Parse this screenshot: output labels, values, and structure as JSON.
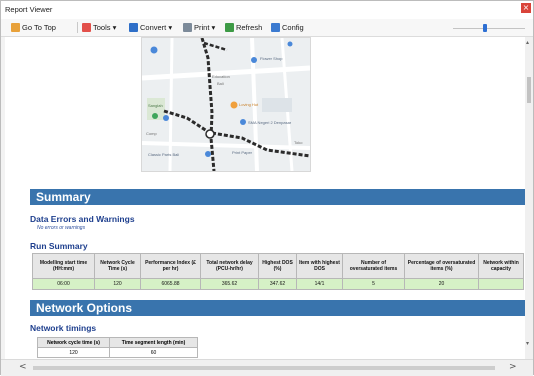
{
  "window": {
    "title": "Report Viewer",
    "close_glyph": "×"
  },
  "toolbar": {
    "go_to_top": "Go To Top",
    "tools": "Tools ▾",
    "convert": "Convert ▾",
    "print": "Print ▾",
    "refresh": "Refresh",
    "config": "Config"
  },
  "map": {
    "labels": [
      "Flower Shop",
      "Education",
      "Bali",
      "Loving Hut",
      "SMA Negeri 2 Denpasar",
      "Sanglah",
      "Comp",
      "Classic Parts Bali",
      "Print Paper",
      "Toko"
    ]
  },
  "summary": {
    "heading": "Summary",
    "data_errors_heading": "Data Errors and Warnings",
    "data_errors_note": "No errors or warnings",
    "run_summary_heading": "Run Summary",
    "columns": [
      "Modelling start time (HH:mm)",
      "Network Cycle Time (s)",
      "Performance Index (£ per hr)",
      "Total network delay (PCU-hr/hr)",
      "Highest DOS (%)",
      "Item with highest DOS",
      "Number of oversaturated items",
      "Percentage of oversaturated items (%)",
      "Network within capacity"
    ],
    "row": [
      "06:00",
      "120",
      "6065.88",
      "365.62",
      "347.62",
      "14/1",
      "5",
      "20",
      ""
    ]
  },
  "network_options": {
    "heading": "Network Options",
    "timings_heading": "Network timings",
    "columns": [
      "Network cycle time (s)",
      "Time segment length (min)"
    ],
    "row": [
      "120",
      "60"
    ]
  },
  "scrollbars": {
    "left": "<",
    "right": ">",
    "up": "▴",
    "down": "▾"
  }
}
